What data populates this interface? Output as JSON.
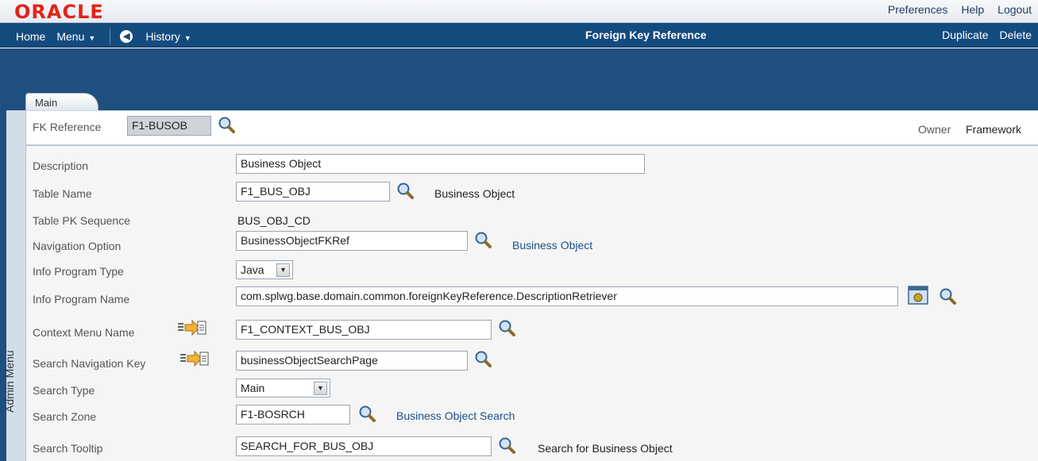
{
  "brand": {
    "logo_text": "ORACLE",
    "logo_color": "#e2231a"
  },
  "top_links": {
    "preferences": "Preferences",
    "help": "Help",
    "logout": "Logout"
  },
  "nav": {
    "home": "Home",
    "menu": "Menu",
    "history": "History",
    "page_title": "Foreign Key Reference",
    "duplicate": "Duplicate",
    "delete": "Delete"
  },
  "tabs": [
    {
      "label": "Main"
    }
  ],
  "sidebar": {
    "label": "Admin Menu"
  },
  "key": {
    "fk_reference_label": "FK Reference",
    "fk_reference_value": "F1-BUSOB",
    "owner_label": "Owner",
    "owner_value": "Framework"
  },
  "form": {
    "description": {
      "label": "Description",
      "value": "Business Object"
    },
    "table_name": {
      "label": "Table Name",
      "value": "F1_BUS_OBJ",
      "desc": "Business Object"
    },
    "table_pk_sequence": {
      "label": "Table PK Sequence",
      "value": "BUS_OBJ_CD"
    },
    "navigation_option": {
      "label": "Navigation Option",
      "value": "BusinessObjectFKRef",
      "desc": "Business Object"
    },
    "info_program_type": {
      "label": "Info Program Type",
      "value": "Java"
    },
    "info_program_name": {
      "label": "Info Program Name",
      "value": "com.splwg.base.domain.common.foreignKeyReference.DescriptionRetriever"
    },
    "context_menu_name": {
      "label": "Context Menu Name",
      "value": "F1_CONTEXT_BUS_OBJ"
    },
    "search_navigation_key": {
      "label": "Search Navigation Key",
      "value": "businessObjectSearchPage"
    },
    "search_type": {
      "label": "Search Type",
      "value": "Main"
    },
    "search_zone": {
      "label": "Search Zone",
      "value": "F1-BOSRCH",
      "desc": "Business Object Search"
    },
    "search_tooltip": {
      "label": "Search Tooltip",
      "value": "SEARCH_FOR_BUS_OBJ",
      "desc": "Search for Business Object"
    }
  },
  "colors": {
    "nav_bg": "#144b7f",
    "link": "#1c4f86",
    "sidebar_bg": "#d3dde8"
  }
}
